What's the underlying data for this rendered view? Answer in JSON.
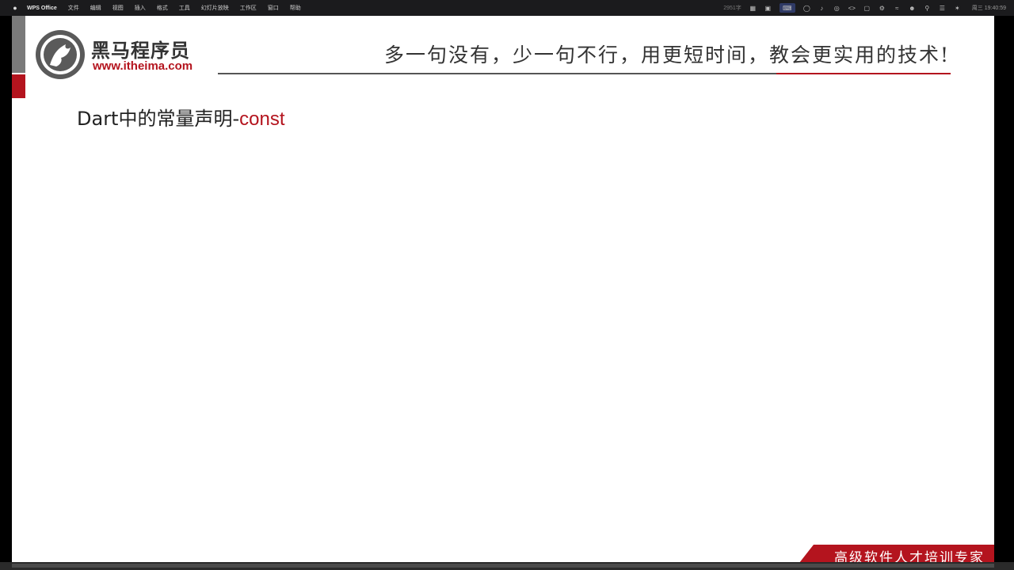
{
  "menubar": {
    "app_name": "WPS Office",
    "items": [
      "文件",
      "编辑",
      "视图",
      "插入",
      "格式",
      "工具",
      "幻灯片放映",
      "工作区",
      "窗口",
      "帮助"
    ],
    "word_count": "2951字",
    "clock": "周三 19:40:59"
  },
  "slide": {
    "logo": {
      "title": "黑马程序员",
      "url": "www.itheima.com"
    },
    "slogan": "多一句没有，少一句不行，用更短时间，教会更实用的技术!",
    "heading": {
      "prefix": "Dart中的常量声明-",
      "keyword": "const"
    },
    "footer": "高级软件人才培训专家"
  },
  "colors": {
    "brand_red": "#b4141e",
    "divider_gray": "#555555"
  }
}
